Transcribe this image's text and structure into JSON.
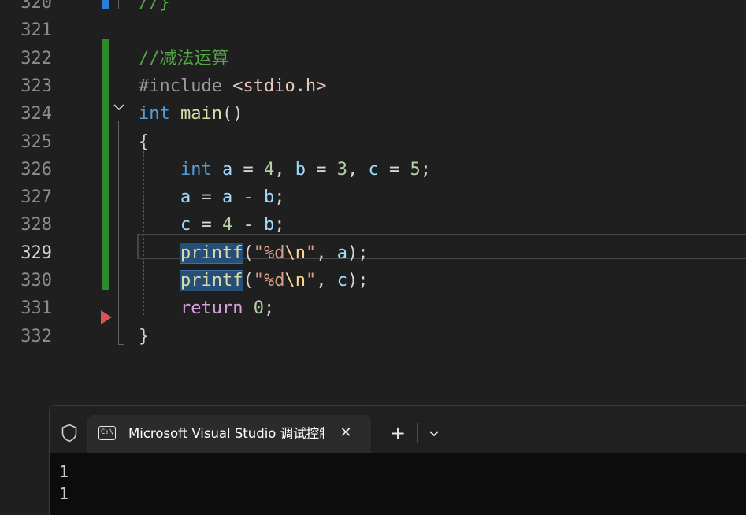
{
  "editor": {
    "current_line": "329",
    "lines": [
      {
        "num": "320",
        "tokens": [
          {
            "t": "//}",
            "c": "t-comment"
          }
        ]
      },
      {
        "num": "321",
        "tokens": []
      },
      {
        "num": "322",
        "tokens": [
          {
            "t": "//减法运算",
            "c": "t-comment"
          }
        ]
      },
      {
        "num": "323",
        "tokens": [
          {
            "t": "#include ",
            "c": "t-pre"
          },
          {
            "t": "<stdio.h>",
            "c": "t-inc"
          }
        ]
      },
      {
        "num": "324",
        "tokens": [
          {
            "t": "int",
            "c": "t-kw"
          },
          {
            "t": " ",
            "c": "t-punc"
          },
          {
            "t": "main",
            "c": "t-fn"
          },
          {
            "t": "()",
            "c": "t-punc"
          }
        ]
      },
      {
        "num": "325",
        "tokens": [
          {
            "t": "{",
            "c": "t-punc"
          }
        ]
      },
      {
        "num": "326",
        "tokens": [
          {
            "t": "    ",
            "c": "t-punc"
          },
          {
            "t": "int",
            "c": "t-kw"
          },
          {
            "t": " ",
            "c": "t-punc"
          },
          {
            "t": "a",
            "c": "t-var"
          },
          {
            "t": " = ",
            "c": "t-punc"
          },
          {
            "t": "4",
            "c": "t-num"
          },
          {
            "t": ", ",
            "c": "t-punc"
          },
          {
            "t": "b",
            "c": "t-var"
          },
          {
            "t": " = ",
            "c": "t-punc"
          },
          {
            "t": "3",
            "c": "t-num"
          },
          {
            "t": ", ",
            "c": "t-punc"
          },
          {
            "t": "c",
            "c": "t-var"
          },
          {
            "t": " = ",
            "c": "t-punc"
          },
          {
            "t": "5",
            "c": "t-num"
          },
          {
            "t": ";",
            "c": "t-punc"
          }
        ]
      },
      {
        "num": "327",
        "tokens": [
          {
            "t": "    ",
            "c": "t-punc"
          },
          {
            "t": "a",
            "c": "t-var"
          },
          {
            "t": " = ",
            "c": "t-punc"
          },
          {
            "t": "a",
            "c": "t-var"
          },
          {
            "t": " - ",
            "c": "t-punc"
          },
          {
            "t": "b",
            "c": "t-var"
          },
          {
            "t": ";",
            "c": "t-punc"
          }
        ]
      },
      {
        "num": "328",
        "tokens": [
          {
            "t": "    ",
            "c": "t-punc"
          },
          {
            "t": "c",
            "c": "t-var"
          },
          {
            "t": " = ",
            "c": "t-punc"
          },
          {
            "t": "4",
            "c": "t-num"
          },
          {
            "t": " - ",
            "c": "t-punc"
          },
          {
            "t": "b",
            "c": "t-var"
          },
          {
            "t": ";",
            "c": "t-punc"
          }
        ]
      },
      {
        "num": "329",
        "tokens": [
          {
            "t": "    ",
            "c": "t-punc"
          },
          {
            "t": "printf",
            "c": "t-fn",
            "hl": true
          },
          {
            "t": "(",
            "c": "t-punc"
          },
          {
            "t": "\"%d",
            "c": "t-str"
          },
          {
            "t": "\\n",
            "c": "t-esc"
          },
          {
            "t": "\"",
            "c": "t-str"
          },
          {
            "t": ", ",
            "c": "t-punc"
          },
          {
            "t": "a",
            "c": "t-var"
          },
          {
            "t": ");",
            "c": "t-punc"
          }
        ]
      },
      {
        "num": "330",
        "tokens": [
          {
            "t": "    ",
            "c": "t-punc"
          },
          {
            "t": "printf",
            "c": "t-fn",
            "hl": true
          },
          {
            "t": "(",
            "c": "t-punc"
          },
          {
            "t": "\"%d",
            "c": "t-str"
          },
          {
            "t": "\\n",
            "c": "t-esc"
          },
          {
            "t": "\"",
            "c": "t-str"
          },
          {
            "t": ", ",
            "c": "t-punc"
          },
          {
            "t": "c",
            "c": "t-var"
          },
          {
            "t": ");",
            "c": "t-punc"
          }
        ]
      },
      {
        "num": "331",
        "tokens": [
          {
            "t": "    ",
            "c": "t-punc"
          },
          {
            "t": "return",
            "c": "t-ctrl"
          },
          {
            "t": " ",
            "c": "t-punc"
          },
          {
            "t": "0",
            "c": "t-num"
          },
          {
            "t": ";",
            "c": "t-punc"
          }
        ]
      },
      {
        "num": "332",
        "tokens": [
          {
            "t": "}",
            "c": "t-punc"
          }
        ]
      }
    ]
  },
  "terminal": {
    "tab_title": "Microsoft Visual Studio 调试控制台",
    "tab_icon_text": "C:\\",
    "close_glyph": "✕",
    "new_tab_glyph": "+",
    "output": [
      "1",
      "1"
    ]
  },
  "icons": {
    "shield": "shield-icon",
    "terminal": "terminal-icon",
    "close": "close-icon",
    "add": "add-tab-icon",
    "dropdown": "chevron-down-icon",
    "fold": "chevron-down-icon",
    "breakpoint_arrow": "next-statement-arrow-icon"
  },
  "colors": {
    "editor_bg": "#1f1f1f",
    "change_bar": "#2d8a2d",
    "selection": "#264f78",
    "arrow": "#e05252",
    "terminal_bg": "#0c0c0c"
  }
}
